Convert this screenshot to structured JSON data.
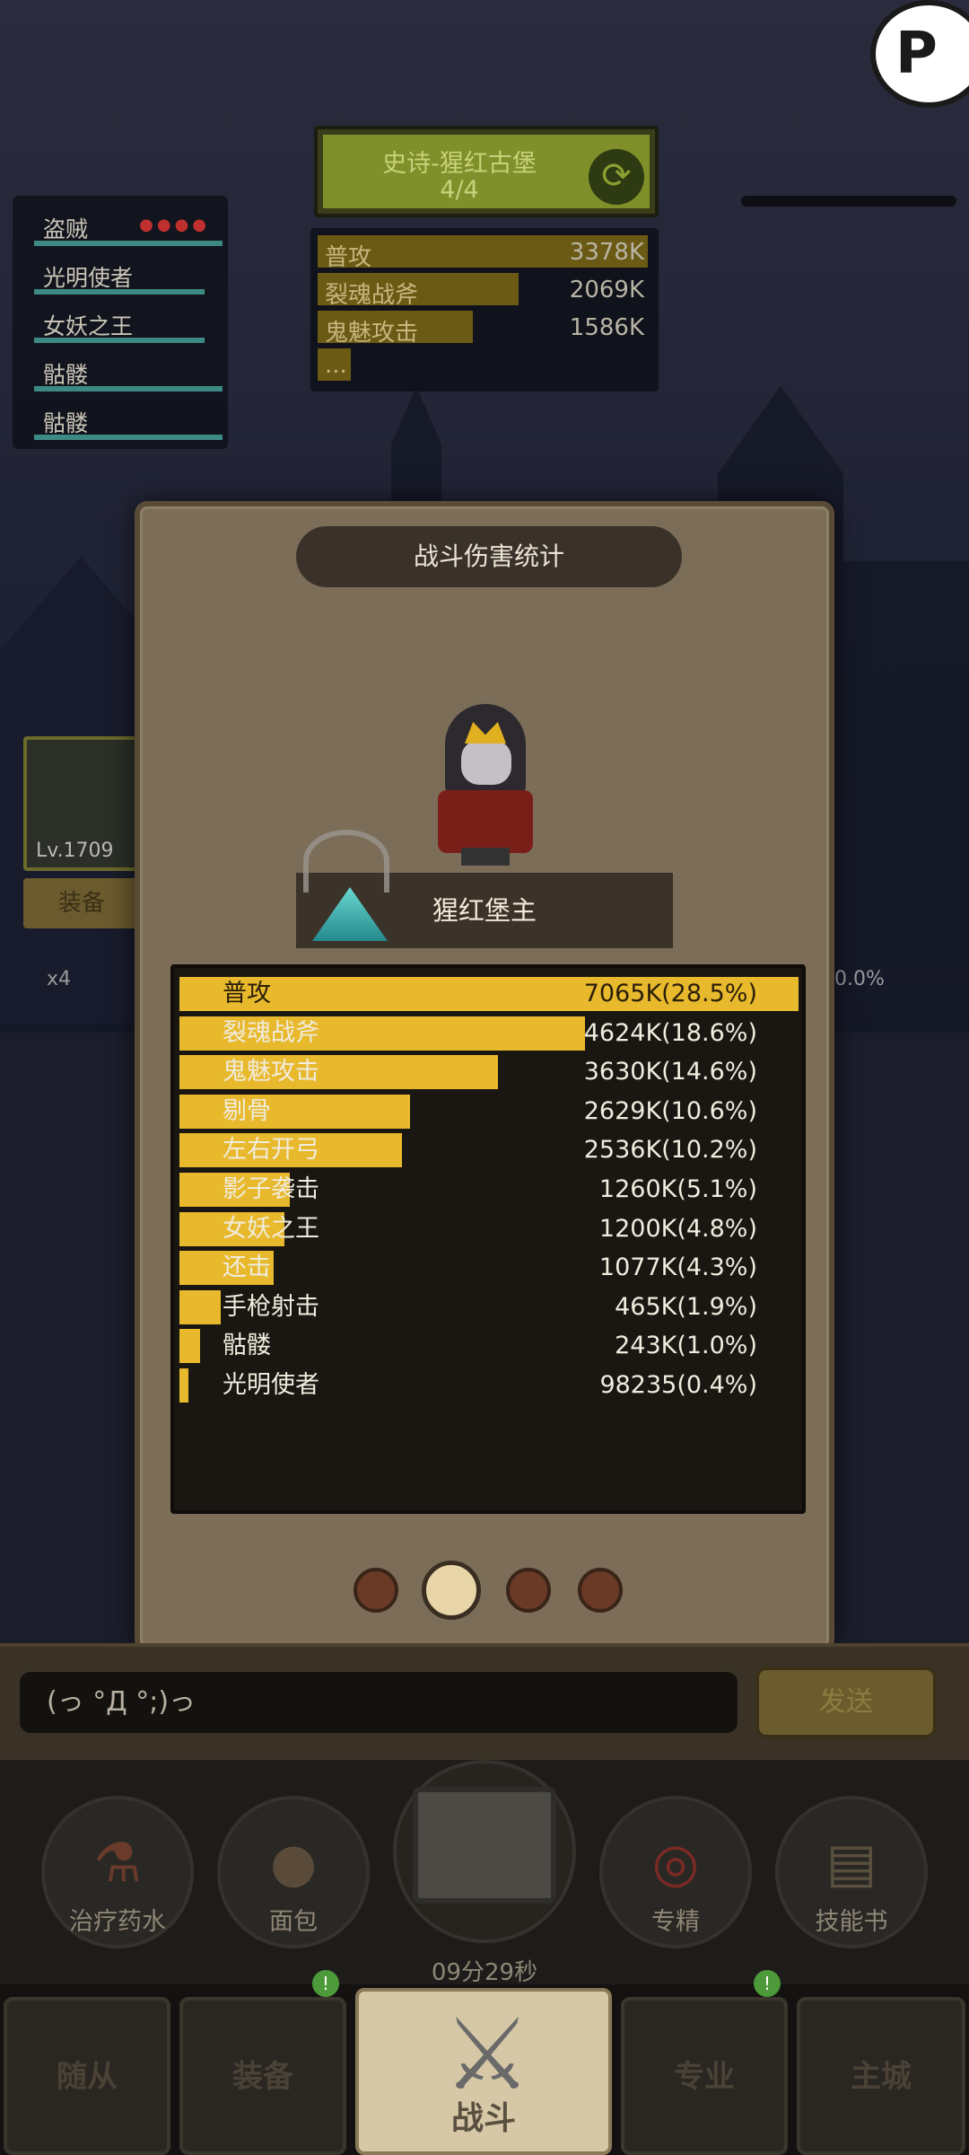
{
  "party": {
    "members": [
      {
        "name": "盗贼",
        "dots": "●●●●"
      },
      {
        "name": "光明使者",
        "dots": ""
      },
      {
        "name": "女妖之王",
        "dots": ""
      },
      {
        "name": "骷髅",
        "dots": ""
      },
      {
        "name": "骷髅",
        "dots": ""
      }
    ]
  },
  "boss_header": {
    "title": "史诗-猩红古堡",
    "count": "4/4",
    "icon": "refresh-icon"
  },
  "mini_stats": [
    {
      "label": "普攻",
      "value": "3378K",
      "fraction": 1.0
    },
    {
      "label": "裂魂战斧",
      "value": "2069K",
      "fraction": 0.61
    },
    {
      "label": "鬼魅攻击",
      "value": "1586K",
      "fraction": 0.47
    },
    {
      "label": "...",
      "value": "",
      "fraction": 0.1
    }
  ],
  "character": {
    "level": "Lv.1709",
    "equip_label": "装备",
    "multiplier": "x4",
    "percent": "0.0%"
  },
  "modal": {
    "title": "战斗伤害统计",
    "boss_name": "猩红堡主",
    "rows": [
      {
        "label": "普攻",
        "value": "7065K(28.5%)",
        "fraction": 1.0
      },
      {
        "label": "裂魂战斧",
        "value": "4624K(18.6%)",
        "fraction": 0.655
      },
      {
        "label": "鬼魅攻击",
        "value": "3630K(14.6%)",
        "fraction": 0.514
      },
      {
        "label": "剔骨",
        "value": "2629K(10.6%)",
        "fraction": 0.372
      },
      {
        "label": "左右开弓",
        "value": "2536K(10.2%)",
        "fraction": 0.359
      },
      {
        "label": "影子袭击",
        "value": "1260K(5.1%)",
        "fraction": 0.178
      },
      {
        "label": "女妖之王",
        "value": "1200K(4.8%)",
        "fraction": 0.17
      },
      {
        "label": "还击",
        "value": "1077K(4.3%)",
        "fraction": 0.152
      },
      {
        "label": "手枪射击",
        "value": "465K(1.9%)",
        "fraction": 0.066
      },
      {
        "label": "骷髅",
        "value": "243K(1.0%)",
        "fraction": 0.034
      },
      {
        "label": "光明使者",
        "value": "98235(0.4%)",
        "fraction": 0.014
      }
    ],
    "pages": 4,
    "active_page": 2
  },
  "chat": {
    "input_text": "(っ °Д °;)っ",
    "send_label": "发送"
  },
  "items": [
    {
      "label": "治疗药水",
      "icon": "potion-icon"
    },
    {
      "label": "面包",
      "icon": "bread-icon"
    },
    {
      "label": "专精",
      "icon": "specialization-icon"
    },
    {
      "label": "技能书",
      "icon": "skill-book-icon"
    }
  ],
  "chest": {
    "timer": "09分29秒",
    "icon": "treasure-chest-icon"
  },
  "nav": {
    "follower": "随从",
    "equipment": "装备",
    "battle": "战斗",
    "profession": "专业",
    "main_city": "主城"
  },
  "colors": {
    "bar_fill": "#e8b92c",
    "modal_bg": "#7b6d57",
    "party_hp": "#3d8a84"
  }
}
